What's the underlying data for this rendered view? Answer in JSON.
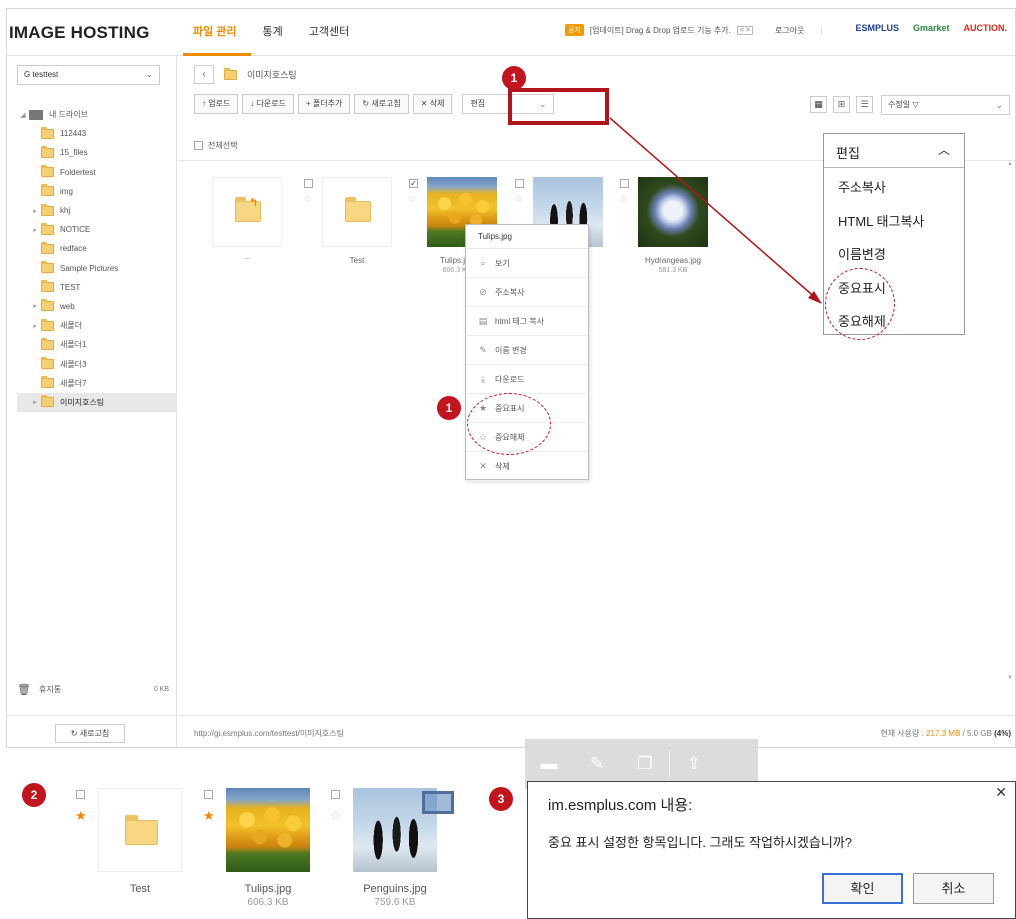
{
  "app": {
    "logo": "IMAGE HOSTING",
    "nav": [
      {
        "label": "파일 관리",
        "active": true
      },
      {
        "label": "통계",
        "active": false
      },
      {
        "label": "고객센터",
        "active": false
      }
    ],
    "notice_badge": "공지",
    "notice_text": "[업데이트] Drag & Drop 업로드 기능 추가.",
    "notice_arrows": "< >",
    "logout": "로그아웃",
    "partners": [
      "ESMPLUS",
      "Gmarket",
      "AUCTION."
    ],
    "partner_colors": [
      "#1f3f8f",
      "#2a8a3a",
      "#e2231a"
    ]
  },
  "sidebar": {
    "account": "G testtest",
    "tree": [
      {
        "label": "내 드라이브",
        "expander": "◢",
        "icon": "drive-icon",
        "depth": 0
      },
      {
        "label": "112443",
        "expander": "",
        "icon": "folder-icon",
        "depth": 1
      },
      {
        "label": "15_files",
        "expander": "",
        "icon": "folder-icon",
        "depth": 1
      },
      {
        "label": "Foldertest",
        "expander": "",
        "icon": "folder-icon",
        "depth": 1
      },
      {
        "label": "img",
        "expander": "",
        "icon": "folder-icon",
        "depth": 1
      },
      {
        "label": "khj",
        "expander": "▸",
        "icon": "folder-icon",
        "depth": 1
      },
      {
        "label": "NOTICE",
        "expander": "▸",
        "icon": "folder-icon",
        "depth": 1
      },
      {
        "label": "redface",
        "expander": "",
        "icon": "folder-icon",
        "depth": 1
      },
      {
        "label": "Sample Pictures",
        "expander": "",
        "icon": "folder-icon",
        "depth": 1
      },
      {
        "label": "TEST",
        "expander": "",
        "icon": "folder-icon",
        "depth": 1
      },
      {
        "label": "web",
        "expander": "▸",
        "icon": "folder-icon",
        "depth": 1
      },
      {
        "label": "새폴더",
        "expander": "▸",
        "icon": "folder-icon",
        "depth": 1
      },
      {
        "label": "새폴더1",
        "expander": "",
        "icon": "folder-icon",
        "depth": 1
      },
      {
        "label": "새폴더3",
        "expander": "",
        "icon": "folder-icon",
        "depth": 1
      },
      {
        "label": "새폴더7",
        "expander": "",
        "icon": "folder-icon",
        "depth": 1
      },
      {
        "label": "이미지호스팅",
        "expander": "▸",
        "icon": "folder-icon",
        "depth": 1,
        "selected": true
      }
    ],
    "trash_label": "휴지통",
    "trash_size": "0 KB",
    "refresh": "새로고침"
  },
  "main": {
    "breadcrumb": "이미지호스팅",
    "toolbar": {
      "upload": "업로드",
      "download": "다운로드",
      "new_folder": "폴더추가",
      "refresh": "새로고침",
      "delete": "삭제",
      "edit_select": "편집"
    },
    "sort": "수정일",
    "select_all": "전체선택",
    "files": [
      {
        "name": "..",
        "size": "",
        "type": "parent"
      },
      {
        "name": "Test",
        "size": "",
        "type": "folder"
      },
      {
        "name": "Tulips.jpg",
        "size": "606.3 KB",
        "type": "image"
      },
      {
        "name": "Penguins.jpg",
        "size": "",
        "type": "image"
      },
      {
        "name": "Hydrangeas.jpg",
        "size": "581.3 KB",
        "type": "image"
      }
    ],
    "status_url": "http://gi.esmplus.com/testtest/이미지호스팅",
    "usage_label": "현재 사용량 :",
    "usage_used": "217.3 MB",
    "usage_total": "/ 5.0 GB",
    "usage_pct": "(4%)"
  },
  "context_menu": {
    "title": "Tulips.jpg",
    "items": [
      {
        "label": "보기",
        "icon": "search-icon",
        "glyph": "⌕"
      },
      {
        "label": "주소복사",
        "icon": "link-icon",
        "glyph": "⊘"
      },
      {
        "label": "html 태그 복사",
        "icon": "html-doc-icon",
        "glyph": "▤"
      },
      {
        "label": "이름 변경",
        "icon": "rename-icon",
        "glyph": "✎"
      },
      {
        "label": "다운로드",
        "icon": "download-icon",
        "glyph": "⤓"
      },
      {
        "label": "중요표시",
        "icon": "star-filled-icon",
        "glyph": "★"
      },
      {
        "label": "중요해제",
        "icon": "star-outline-icon",
        "glyph": "☆"
      },
      {
        "label": "삭제",
        "icon": "close-icon",
        "glyph": "✕"
      }
    ]
  },
  "edit_dropdown": {
    "head": "편집",
    "items": [
      "주소복사",
      "HTML 태그복사",
      "이름변경",
      "중요표시",
      "중요해제"
    ]
  },
  "annotations": {
    "step1": "1",
    "step2": "2",
    "step3": "3"
  },
  "bottom": {
    "files": [
      {
        "name": "Test",
        "size": "",
        "starred": true
      },
      {
        "name": "Tulips.jpg",
        "size": "606.3 KB",
        "starred": true
      },
      {
        "name": "Penguins.jpg",
        "size": "759.6 KB",
        "starred": false
      }
    ]
  },
  "dialog": {
    "title": "im.esmplus.com 내용:",
    "message": "중요 표시 설정한 항목입니다. 그래도 작업하시겠습니까?",
    "ok": "확인",
    "cancel": "취소"
  },
  "colors": {
    "accent": "#f08a00",
    "annotation_red": "#c1141c"
  }
}
